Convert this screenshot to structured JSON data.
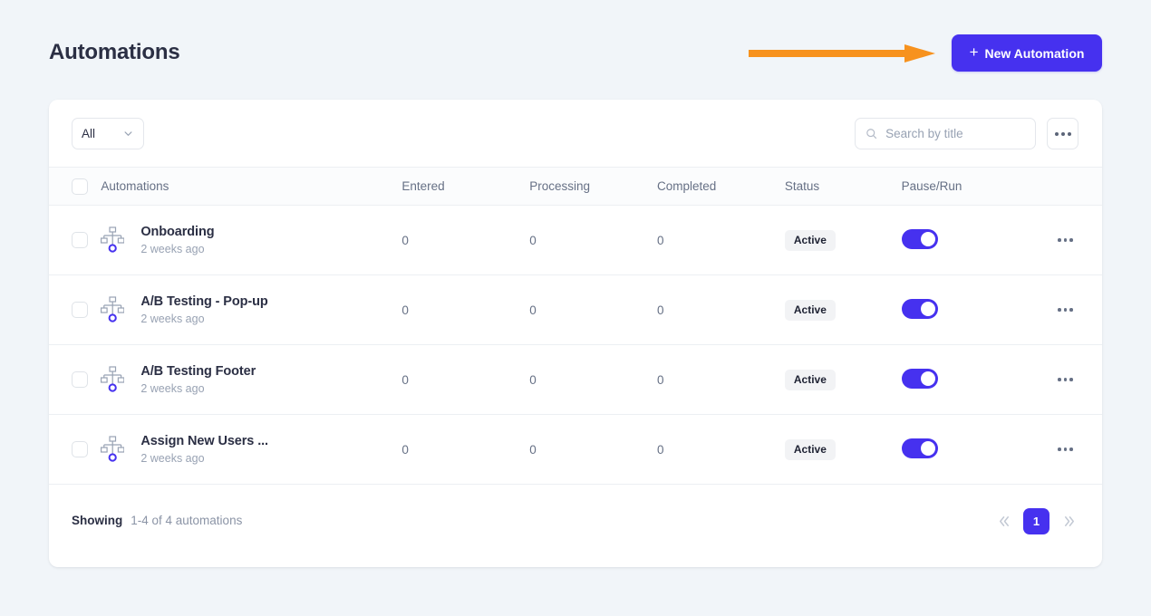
{
  "header": {
    "title": "Automations",
    "new_button_label": "New Automation",
    "new_button_icon": "plus-icon",
    "annotation_arrow_color": "#f7921e",
    "accent_color": "#4631ef"
  },
  "toolbar": {
    "filter_selected": "All",
    "filter_icon": "chevron-down-icon",
    "search_placeholder": "Search by title",
    "search_value": "",
    "search_icon": "search-icon",
    "more_icon": "ellipsis-icon"
  },
  "table": {
    "columns": [
      "Automations",
      "Entered",
      "Processing",
      "Completed",
      "Status",
      "Pause/Run"
    ],
    "row_icon": "flowchart-icon",
    "rows": [
      {
        "title": "Onboarding",
        "subtitle": "2 weeks ago",
        "entered": "0",
        "processing": "0",
        "completed": "0",
        "status": "Active",
        "toggle_on": true
      },
      {
        "title": "A/B Testing - Pop-up",
        "subtitle": "2 weeks ago",
        "entered": "0",
        "processing": "0",
        "completed": "0",
        "status": "Active",
        "toggle_on": true
      },
      {
        "title": "A/B Testing Footer",
        "subtitle": "2 weeks ago",
        "entered": "0",
        "processing": "0",
        "completed": "0",
        "status": "Active",
        "toggle_on": true
      },
      {
        "title": "Assign New Users ...",
        "subtitle": "2 weeks ago",
        "entered": "0",
        "processing": "0",
        "completed": "0",
        "status": "Active",
        "toggle_on": true
      }
    ]
  },
  "footer": {
    "showing_label": "Showing",
    "showing_range": "1-4 of 4 automations",
    "first_page_icon": "double-chevron-left-icon",
    "last_page_icon": "double-chevron-right-icon",
    "current_page": "1"
  }
}
